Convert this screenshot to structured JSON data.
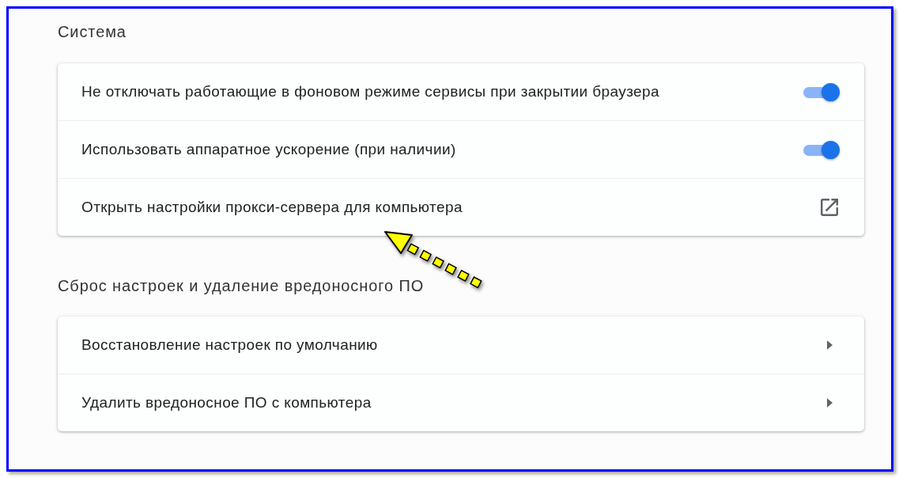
{
  "sections": [
    {
      "title": "Система",
      "rows": [
        {
          "kind": "toggle",
          "label": "Не отключать работающие в фоновом режиме сервисы при закрытии браузера",
          "on": true
        },
        {
          "kind": "toggle",
          "label": "Использовать аппаратное ускорение (при наличии)",
          "on": true
        },
        {
          "kind": "external",
          "label": "Открыть настройки прокси-сервера для компьютера"
        }
      ]
    },
    {
      "title": "Сброс настроек и удаление вредоносного ПО",
      "rows": [
        {
          "kind": "submenu",
          "label": "Восстановление настроек по умолчанию"
        },
        {
          "kind": "submenu",
          "label": "Удалить вредоносное ПО с компьютера"
        }
      ]
    }
  ]
}
